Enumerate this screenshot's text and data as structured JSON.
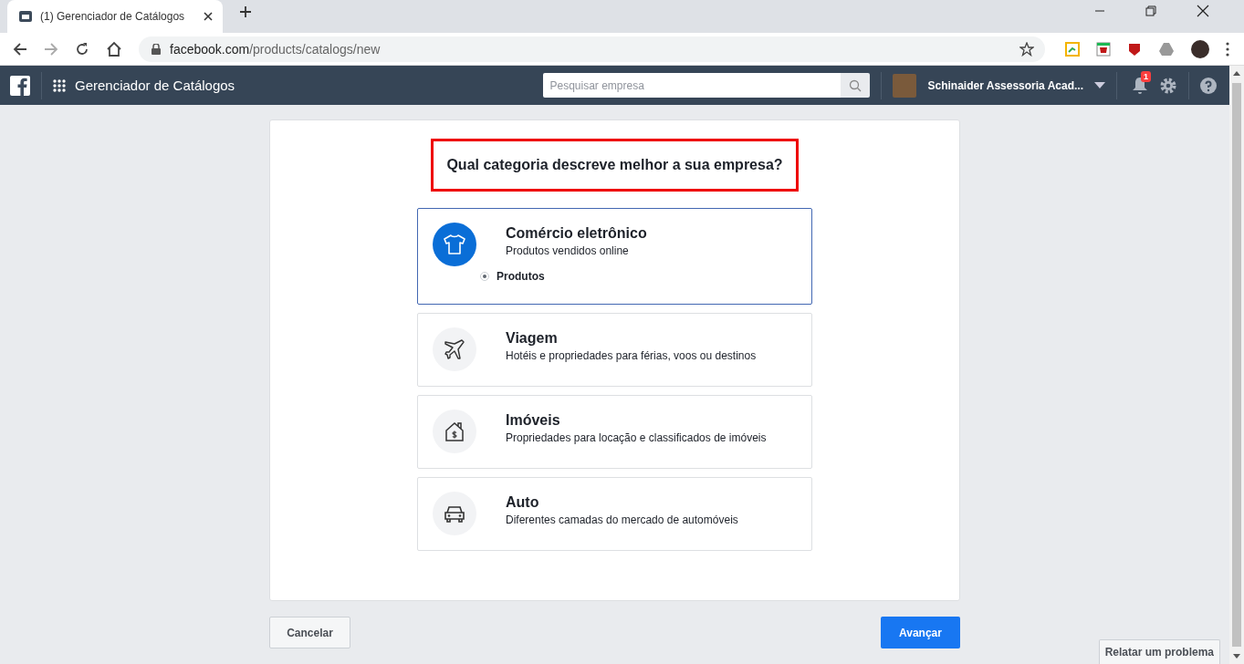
{
  "browser": {
    "tab_title": "(1) Gerenciador de Catálogos",
    "url_host": "facebook.com",
    "url_path": "/products/catalogs/new"
  },
  "header": {
    "app_title": "Gerenciador de Catálogos",
    "search": {
      "placeholder": "Pesquisar empresa"
    },
    "account": "Schinaider Assessoria Acad...",
    "notification_count": "1"
  },
  "question": "Qual categoria descreve melhor a sua empresa?",
  "categories": [
    {
      "kind": "shirt",
      "title": "Comércio eletrônico",
      "description": "Produtos vendidos online",
      "selected": true,
      "options": [
        {
          "label": "Produtos",
          "selected": true
        }
      ]
    },
    {
      "kind": "plane",
      "title": "Viagem",
      "description": "Hotéis e propriedades para férias, voos ou destinos",
      "selected": false
    },
    {
      "kind": "house",
      "title": "Imóveis",
      "description": "Propriedades para locação e classificados de imóveis",
      "selected": false
    },
    {
      "kind": "car",
      "title": "Auto",
      "description": "Diferentes camadas do mercado de automóveis",
      "selected": false
    }
  ],
  "buttons": {
    "cancel": "Cancelar",
    "next": "Avançar"
  },
  "report_button": "Relatar um problema"
}
